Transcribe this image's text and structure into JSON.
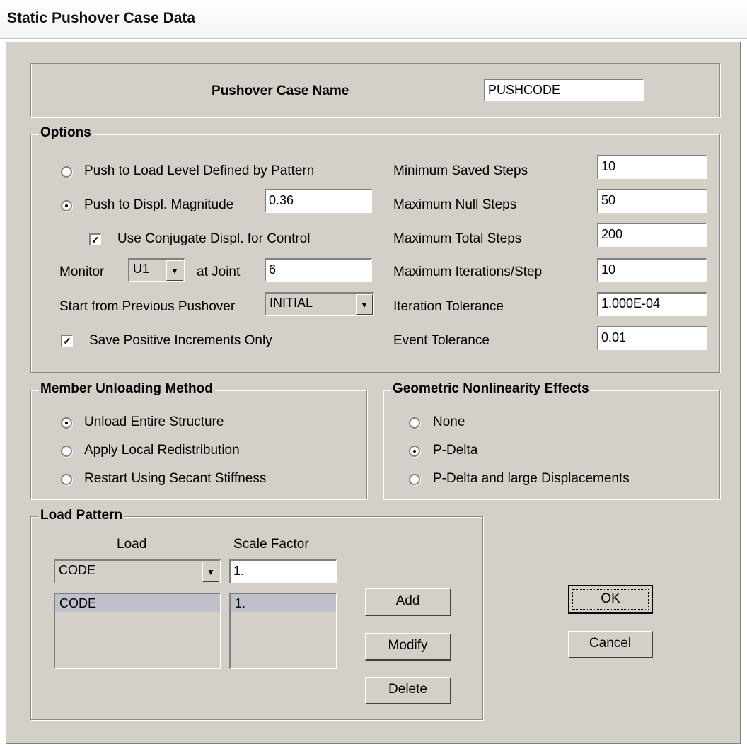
{
  "window": {
    "title": "Static Pushover Case Data"
  },
  "case_name": {
    "label": "Pushover Case  Name",
    "value": "PUSHCODE"
  },
  "options": {
    "heading": "Options",
    "push_load_level": {
      "label": "Push to Load Level Defined by Pattern",
      "selected": false
    },
    "push_displ": {
      "label": "Push to Displ. Magnitude",
      "selected": true,
      "value": "0.36"
    },
    "use_conjugate": {
      "label": "Use Conjugate Displ. for Control",
      "checked": true
    },
    "monitor": {
      "label": "Monitor",
      "dof": "U1",
      "at_joint_label": "at Joint",
      "joint": "6"
    },
    "start_from": {
      "label": "Start from Previous Pushover",
      "value": "INITIAL"
    },
    "save_positive": {
      "label": "Save Positive Increments Only",
      "checked": true
    },
    "min_saved_steps": {
      "label": "Minimum Saved Steps",
      "value": "10"
    },
    "max_null_steps": {
      "label": "Maximum Null Steps",
      "value": "50"
    },
    "max_total_steps": {
      "label": "Maximum Total Steps",
      "value": "200"
    },
    "max_iterations": {
      "label": "Maximum Iterations/Step",
      "value": "10"
    },
    "iteration_tolerance": {
      "label": "Iteration Tolerance",
      "value": "1.000E-04"
    },
    "event_tolerance": {
      "label": "Event Tolerance",
      "value": "0.01"
    }
  },
  "unloading": {
    "heading": "Member Unloading Method",
    "entire": {
      "label": "Unload Entire Structure",
      "selected": true
    },
    "local": {
      "label": "Apply Local Redistribution",
      "selected": false
    },
    "secant": {
      "label": "Restart Using Secant Stiffness",
      "selected": false
    }
  },
  "geometric": {
    "heading": "Geometric Nonlinearity Effects",
    "none": {
      "label": "None",
      "selected": false
    },
    "pdelta": {
      "label": "P-Delta",
      "selected": true
    },
    "pdelta_large": {
      "label": "P-Delta and large Displacements",
      "selected": false
    }
  },
  "load_pattern": {
    "heading": "Load Pattern",
    "load_col": "Load",
    "scale_col": "Scale Factor",
    "load_value": "CODE",
    "scale_value": "1.",
    "rows": [
      {
        "load": "CODE",
        "scale": "1."
      }
    ],
    "add": "Add",
    "modify": "Modify",
    "delete": "Delete"
  },
  "buttons": {
    "ok": "OK",
    "cancel": "Cancel"
  },
  "icons": {
    "dropdown": "chevron-down-icon",
    "check": "checkmark-icon"
  }
}
